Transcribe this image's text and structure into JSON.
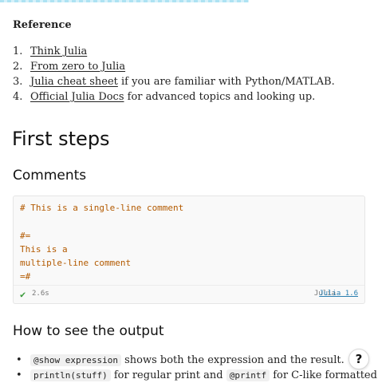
{
  "reference": {
    "heading": "Reference",
    "items": [
      {
        "number": "1.",
        "link": "Think Julia",
        "text": ""
      },
      {
        "number": "2.",
        "link": "From zero to Julia",
        "text": ""
      },
      {
        "number": "3.",
        "link": "Julia cheat sheet",
        "text": " if you are familiar with Python/MATLAB."
      },
      {
        "number": "4.",
        "link": "Official Julia Docs",
        "text": " for advanced topics and looking up."
      }
    ]
  },
  "section_title": "First steps",
  "comments": {
    "heading": "Comments",
    "code": "# This is a single-line comment\n\n#=\nThis is a\nmultiple-line comment\n=#",
    "runtime": "2.6s",
    "language": "Julia",
    "version": "Julia 1.6"
  },
  "output": {
    "heading": "How to see the output",
    "items": [
      {
        "code": "@show expression",
        "text": " shows both the expression and the result."
      },
      {
        "code": "println(stuff)",
        "text": " for regular print and ",
        "code2": "@printf",
        "text2": " for C-like formatted"
      }
    ]
  },
  "help": {
    "label": "?"
  },
  "colors": {
    "accent_link": "#2a7fb0",
    "code_text": "#b35a00",
    "success": "#3a9b3a"
  }
}
